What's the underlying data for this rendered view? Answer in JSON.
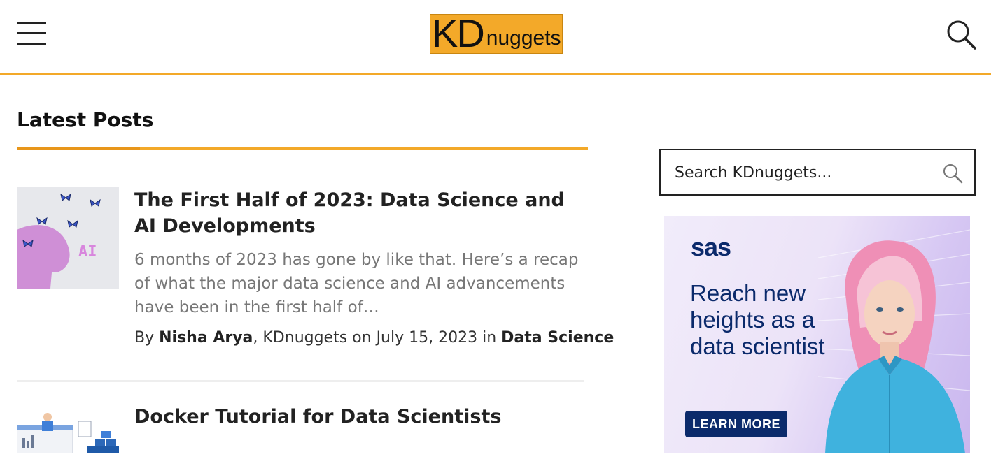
{
  "header": {
    "logo": {
      "kd": "KD",
      "nuggets": "nuggets"
    },
    "menu_icon": "hamburger-icon",
    "search_icon": "search-icon",
    "accent_color": "#f3a929"
  },
  "main": {
    "section_title": "Latest Posts",
    "posts": [
      {
        "title": "The First Half of 2023: Data Science and AI Developments",
        "excerpt": "6 months of 2023 has gone by like that. Here’s a recap of what the major data science and AI advancements have been in the first half of…",
        "by_prefix": "By ",
        "author": "Nisha Arya",
        "source_date": ", KDnuggets on July 15, 2023 in ",
        "category": "Data Science",
        "thumb_label": "AI"
      },
      {
        "title": "Docker Tutorial for Data Scientists"
      }
    ]
  },
  "sidebar": {
    "search_placeholder": "Search KDnuggets...",
    "ad": {
      "brand": "sas",
      "headline": "Reach new heights as a data scientist",
      "cta": "LEARN MORE"
    }
  }
}
